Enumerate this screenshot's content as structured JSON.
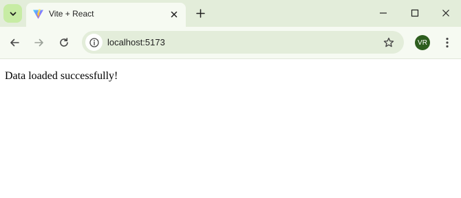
{
  "tab": {
    "title": "Vite + React",
    "favicon": "vite-logo-icon"
  },
  "toolbar": {
    "url": "localhost:5173",
    "profile_initials": "VR"
  },
  "page": {
    "message": "Data loaded successfully!"
  },
  "colors": {
    "titlebar": "#e3edda",
    "active_tab": "#f6faf2",
    "tab_search_button": "#c7eca4",
    "omnibox": "#e3edda",
    "avatar": "#2d5e1e"
  }
}
